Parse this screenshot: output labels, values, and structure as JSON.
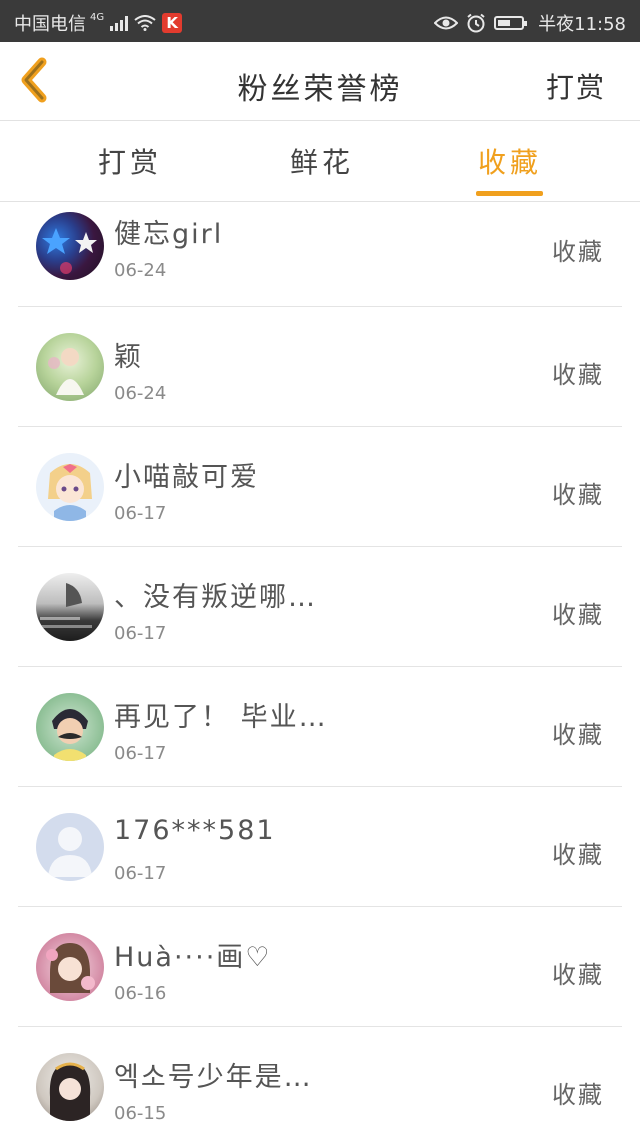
{
  "status_bar": {
    "carrier": "中国电信",
    "network": "4G",
    "time": "半夜11:58"
  },
  "header": {
    "title": "粉丝荣誉榜",
    "action_label": "打赏"
  },
  "tabs": [
    {
      "label": "打赏",
      "active": false
    },
    {
      "label": "鲜花",
      "active": false
    },
    {
      "label": "收藏",
      "active": true
    }
  ],
  "colors": {
    "accent": "#f0a01e",
    "status_bar": "#3a3a3a",
    "divider": "#e2e2e2"
  },
  "list": [
    {
      "name": "健忘girl",
      "date": "06-24",
      "action": "收藏"
    },
    {
      "name": "颖",
      "date": "06-24",
      "action": "收藏"
    },
    {
      "name": "小喵敲可爱",
      "date": "06-17",
      "action": "收藏"
    },
    {
      "name": "、没有叛逆哪…",
      "date": "06-17",
      "action": "收藏"
    },
    {
      "name": "再见了！ 毕业…",
      "date": "06-17",
      "action": "收藏"
    },
    {
      "name": "176***581",
      "date": "06-17",
      "action": "收藏"
    },
    {
      "name": "Huà····画♡",
      "date": "06-16",
      "action": "收藏"
    },
    {
      "name": "엑소号少年是…",
      "date": "06-15",
      "action": "收藏"
    }
  ]
}
